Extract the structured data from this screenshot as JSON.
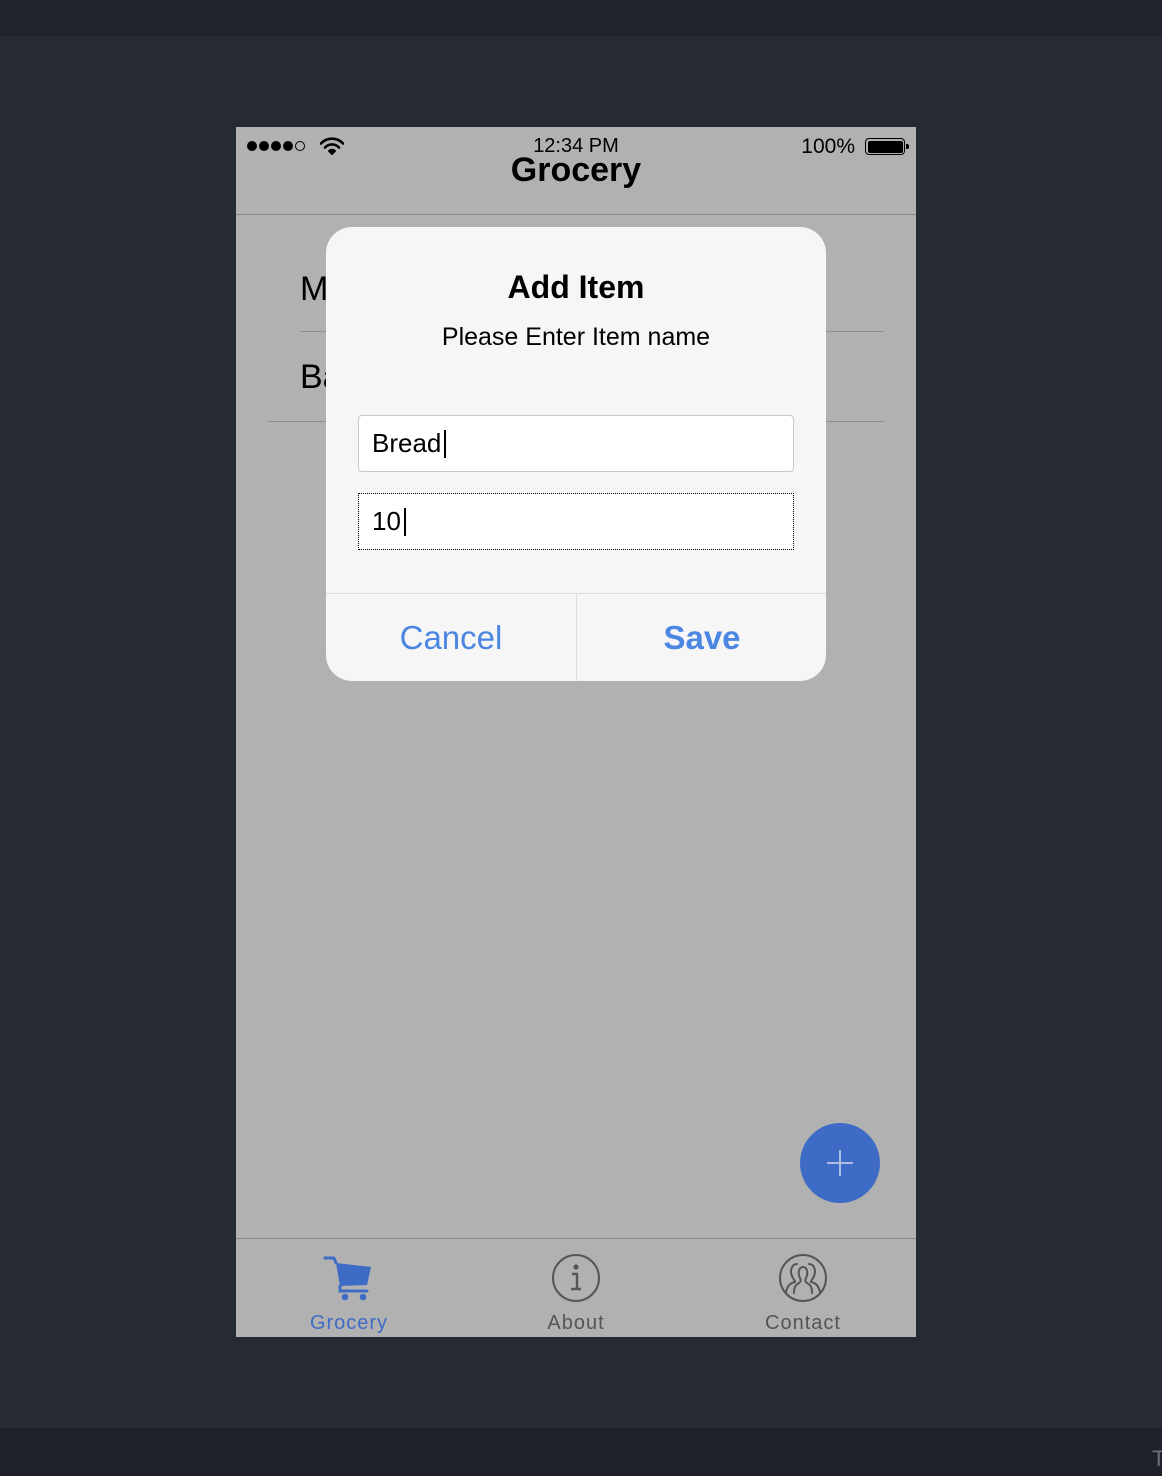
{
  "status_bar": {
    "time": "12:34 PM",
    "battery": "100%",
    "signal_bars": 4,
    "signal_total": 5
  },
  "nav": {
    "title": "Grocery"
  },
  "list": {
    "items": [
      {
        "label": "M"
      },
      {
        "label": "Ba"
      }
    ]
  },
  "dialog": {
    "title": "Add Item",
    "message": "Please Enter Item name",
    "name_value": "Bread",
    "quantity_value": "10",
    "cancel_label": "Cancel",
    "save_label": "Save"
  },
  "fab": {
    "icon": "plus-icon"
  },
  "tabs": [
    {
      "label": "Grocery",
      "icon": "cart-icon",
      "active": true
    },
    {
      "label": "About",
      "icon": "info-icon",
      "active": false
    },
    {
      "label": "Contact",
      "icon": "contacts-icon",
      "active": false
    }
  ],
  "colors": {
    "accent": "#3e6bc5",
    "dialog_button": "#4b86e2",
    "tab_inactive": "#555555",
    "overlay_background": "#b1b1b1"
  },
  "footer": {
    "edge_char": "T"
  }
}
